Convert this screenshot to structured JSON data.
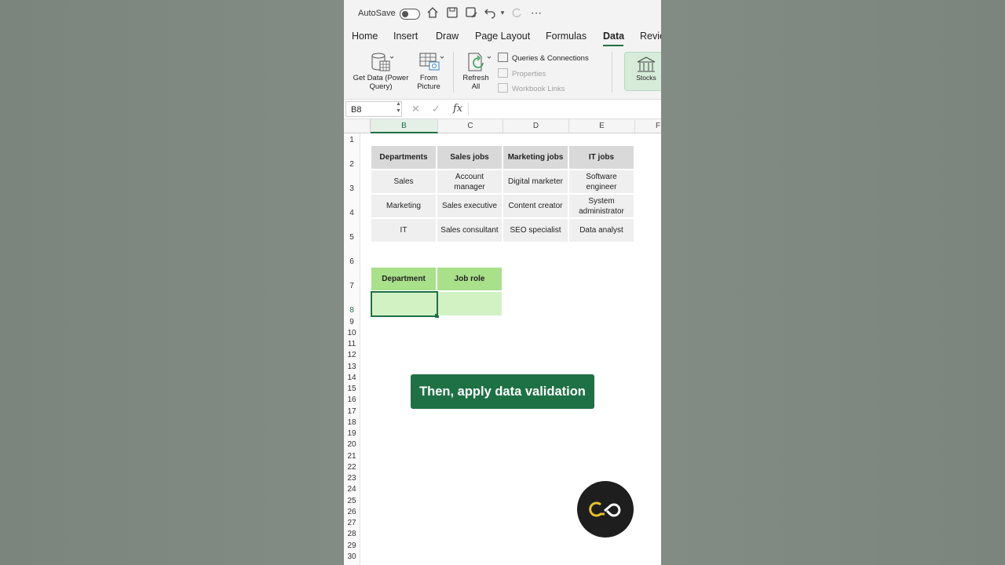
{
  "titlebar": {
    "autosave_label": "AutoSave"
  },
  "tabs": [
    "Home",
    "Insert",
    "Draw",
    "Page Layout",
    "Formulas",
    "Data",
    "Revie"
  ],
  "active_tab": "Data",
  "ribbon": {
    "get_data": "Get Data (Power Query)",
    "from_picture": "From Picture",
    "refresh_all": "Refresh All",
    "queries": "Queries & Connections",
    "properties": "Properties",
    "workbook_links": "Workbook Links",
    "stocks": "Stocks"
  },
  "formula_bar": {
    "name_box": "B8",
    "fx": "fx"
  },
  "sheet": {
    "columns": [
      "B",
      "C",
      "D",
      "E",
      "F"
    ],
    "selected_column": "B",
    "rows": [
      "1",
      "2",
      "3",
      "4",
      "5",
      "6",
      "7",
      "8",
      "9",
      "10",
      "11",
      "12",
      "13",
      "14",
      "15",
      "16",
      "17",
      "18",
      "19",
      "20",
      "21",
      "22",
      "23",
      "24",
      "25",
      "26",
      "27",
      "28",
      "29",
      "30"
    ],
    "table1": {
      "headers": [
        "Departments",
        "Sales jobs",
        "Marketing jobs",
        "IT jobs"
      ],
      "rows": [
        [
          "Sales",
          "Account manager",
          "Digital marketer",
          "Software engineer"
        ],
        [
          "Marketing",
          "Sales executive",
          "Content creator",
          "System administrator"
        ],
        [
          "IT",
          "Sales consultant",
          "SEO specialist",
          "Data analyst"
        ]
      ]
    },
    "table2": {
      "headers": [
        "Department",
        "Job role"
      ]
    }
  },
  "caption": "Then, apply data validation",
  "colors": {
    "accent": "#1e7145",
    "header_gray": "#d9d9d9",
    "green_header": "#a9e08a",
    "green_cell": "#d3f2c4"
  }
}
